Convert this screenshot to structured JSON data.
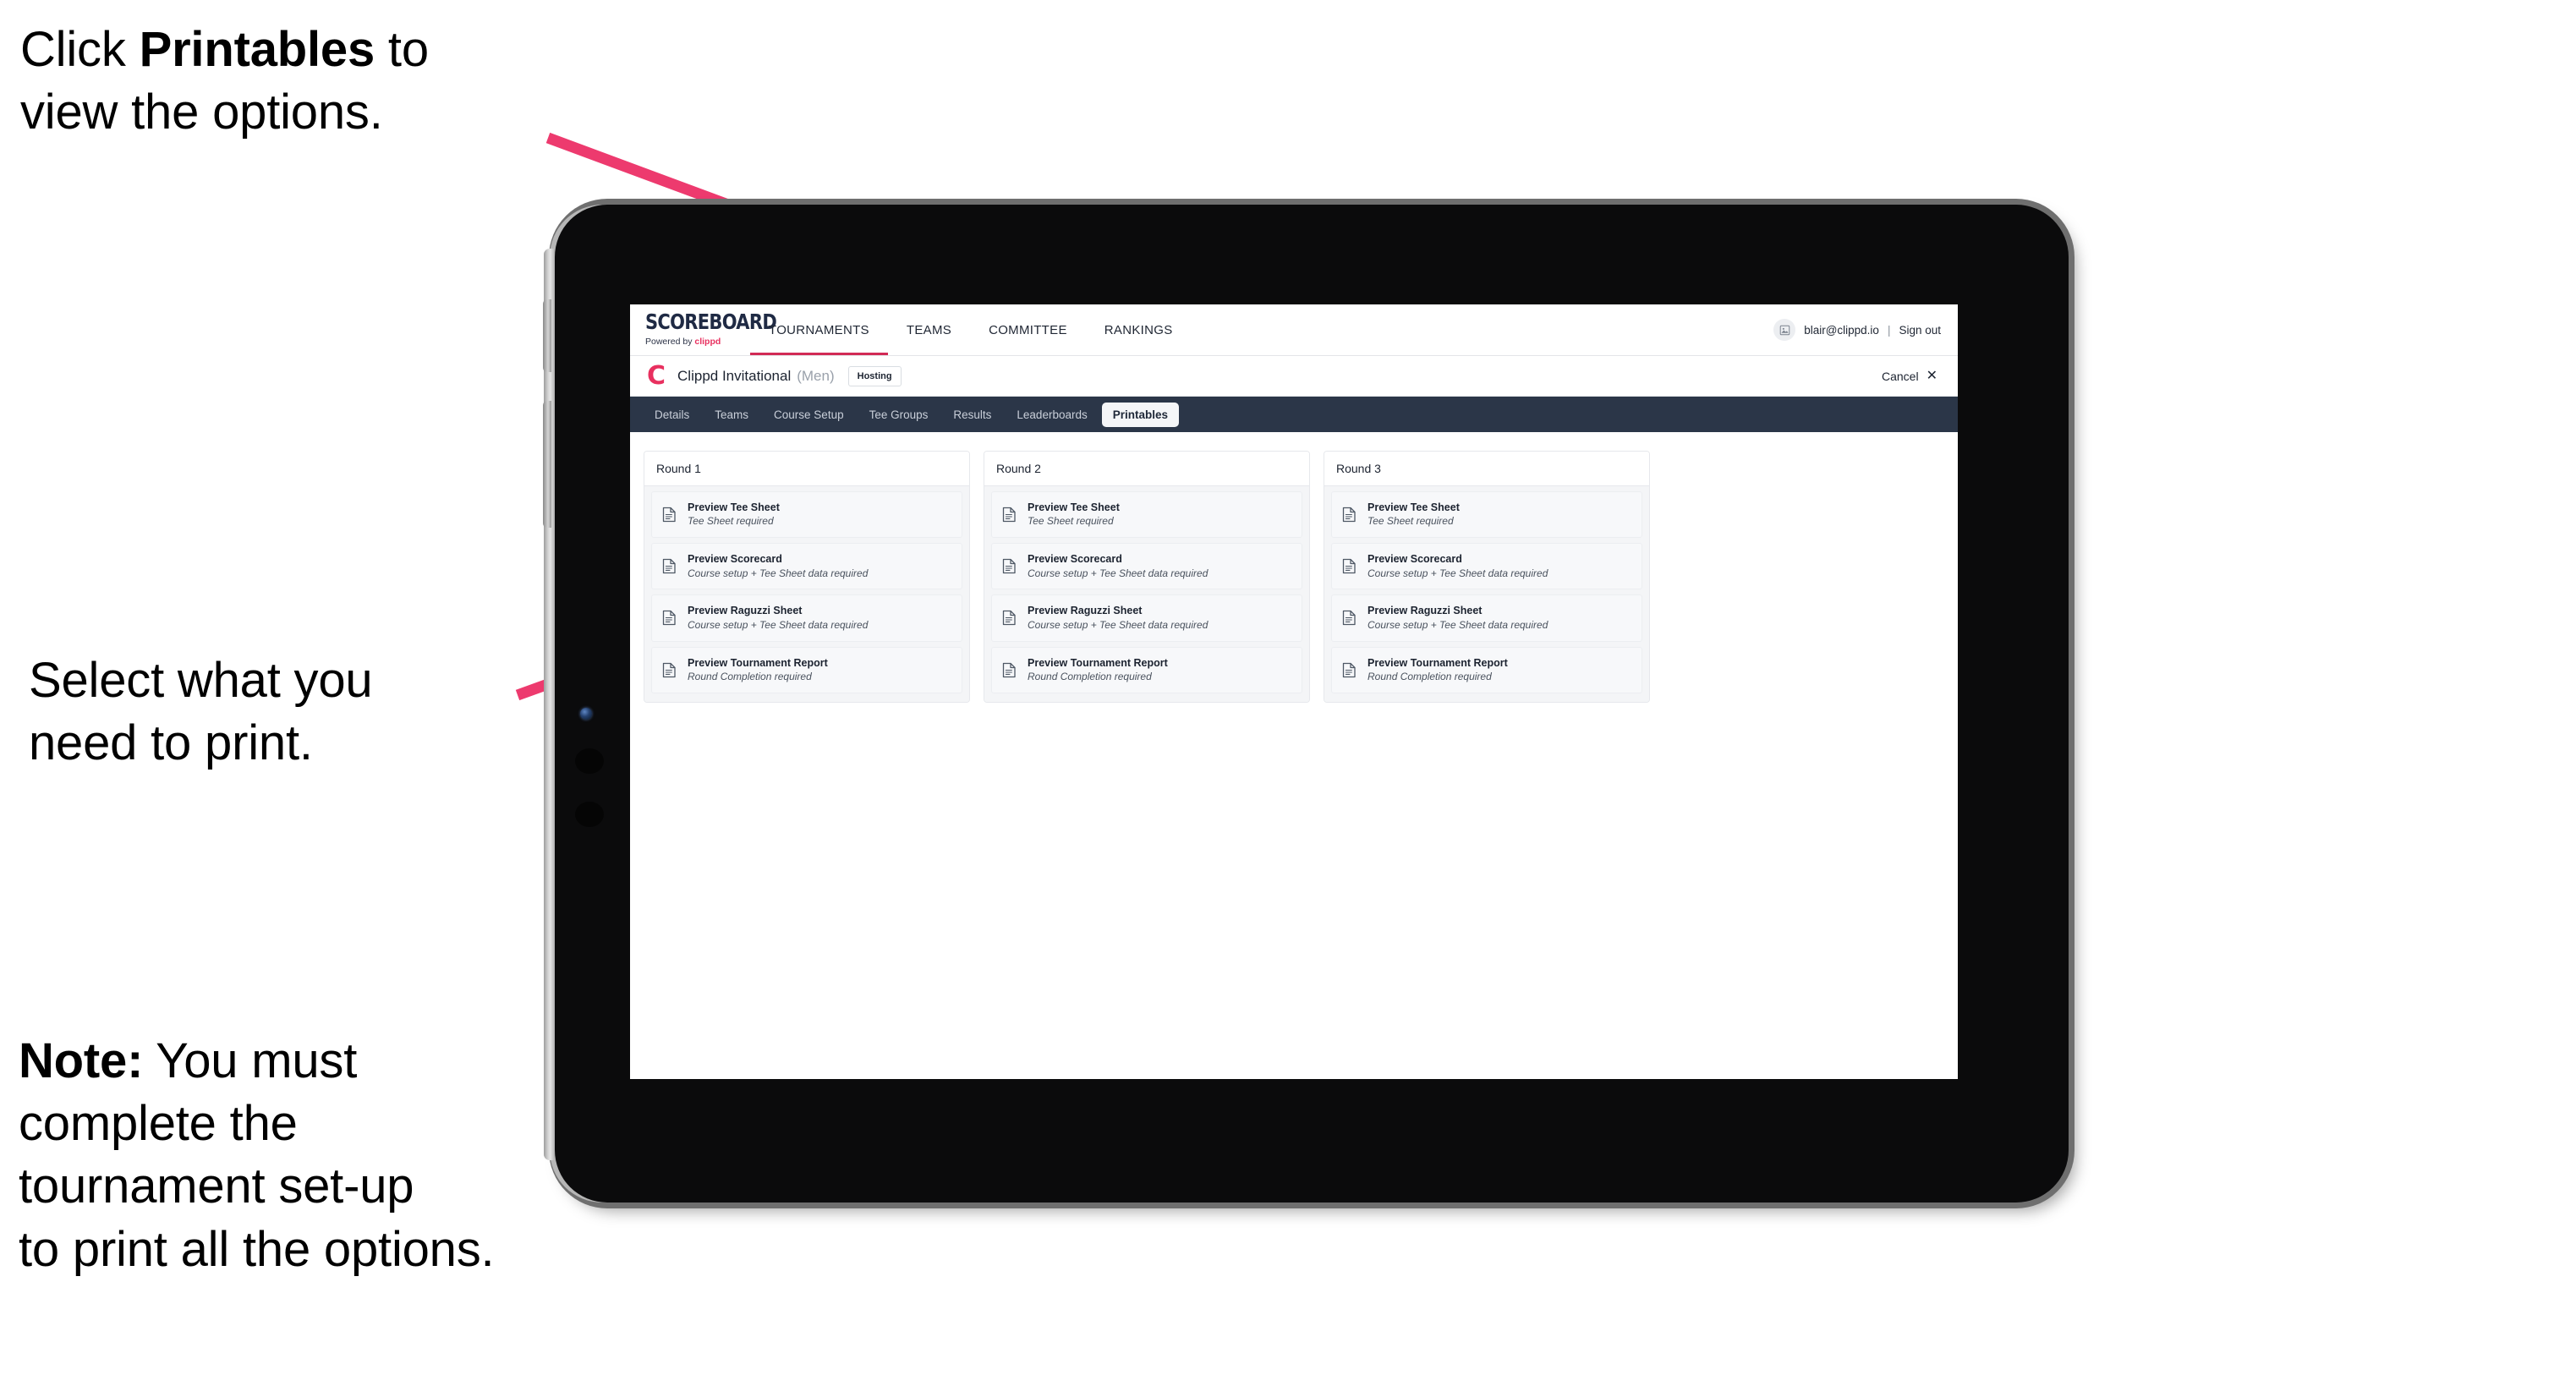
{
  "annotations": {
    "top": {
      "prefix": "Click ",
      "bold": "Printables",
      "suffix": " to\nview the options."
    },
    "middle": "Select what you\n need to print.",
    "note": {
      "bold": "Note:",
      "rest": " You must\ncomplete the\ntournament set-up\nto print all the options."
    }
  },
  "colors": {
    "arrow_pink": "#ED3A6E",
    "tabbar_navy": "#2B3648",
    "brand_pink": "#E8305F",
    "nav_underline": "#D22A55"
  },
  "app": {
    "brand": {
      "title": "SCOREBOARD",
      "powered_prefix": "Powered by ",
      "powered_brand": "clippd"
    },
    "topnav": [
      {
        "label": "TOURNAMENTS",
        "active": true
      },
      {
        "label": "TEAMS",
        "active": false
      },
      {
        "label": "COMMITTEE",
        "active": false
      },
      {
        "label": "RANKINGS",
        "active": false
      }
    ],
    "account": {
      "avatar_icon": "user-avatar-icon",
      "email": "blair@clippd.io",
      "separator": "|",
      "sign_out": "Sign out"
    },
    "title_row": {
      "logo_letter": "C",
      "tournament_name": "Clippd Invitational",
      "gender": "(Men)",
      "status_badge": "Hosting",
      "cancel_label": "Cancel",
      "cancel_icon": "close-x-icon"
    },
    "tabs": [
      {
        "label": "Details",
        "active": false
      },
      {
        "label": "Teams",
        "active": false
      },
      {
        "label": "Course Setup",
        "active": false
      },
      {
        "label": "Tee Groups",
        "active": false
      },
      {
        "label": "Results",
        "active": false
      },
      {
        "label": "Leaderboards",
        "active": false
      },
      {
        "label": "Printables",
        "active": true
      }
    ],
    "rounds": [
      {
        "heading": "Round 1",
        "items": [
          {
            "title": "Preview Tee Sheet",
            "requirement": "Tee Sheet required"
          },
          {
            "title": "Preview Scorecard",
            "requirement": "Course setup + Tee Sheet data required"
          },
          {
            "title": "Preview Raguzzi Sheet",
            "requirement": "Course setup + Tee Sheet data required"
          },
          {
            "title": "Preview Tournament Report",
            "requirement": "Round Completion required"
          }
        ]
      },
      {
        "heading": "Round 2",
        "items": [
          {
            "title": "Preview Tee Sheet",
            "requirement": "Tee Sheet required"
          },
          {
            "title": "Preview Scorecard",
            "requirement": "Course setup + Tee Sheet data required"
          },
          {
            "title": "Preview Raguzzi Sheet",
            "requirement": "Course setup + Tee Sheet data required"
          },
          {
            "title": "Preview Tournament Report",
            "requirement": "Round Completion required"
          }
        ]
      },
      {
        "heading": "Round 3",
        "items": [
          {
            "title": "Preview Tee Sheet",
            "requirement": "Tee Sheet required"
          },
          {
            "title": "Preview Scorecard",
            "requirement": "Course setup + Tee Sheet data required"
          },
          {
            "title": "Preview Raguzzi Sheet",
            "requirement": "Course setup + Tee Sheet data required"
          },
          {
            "title": "Preview Tournament Report",
            "requirement": "Round Completion required"
          }
        ]
      }
    ]
  }
}
